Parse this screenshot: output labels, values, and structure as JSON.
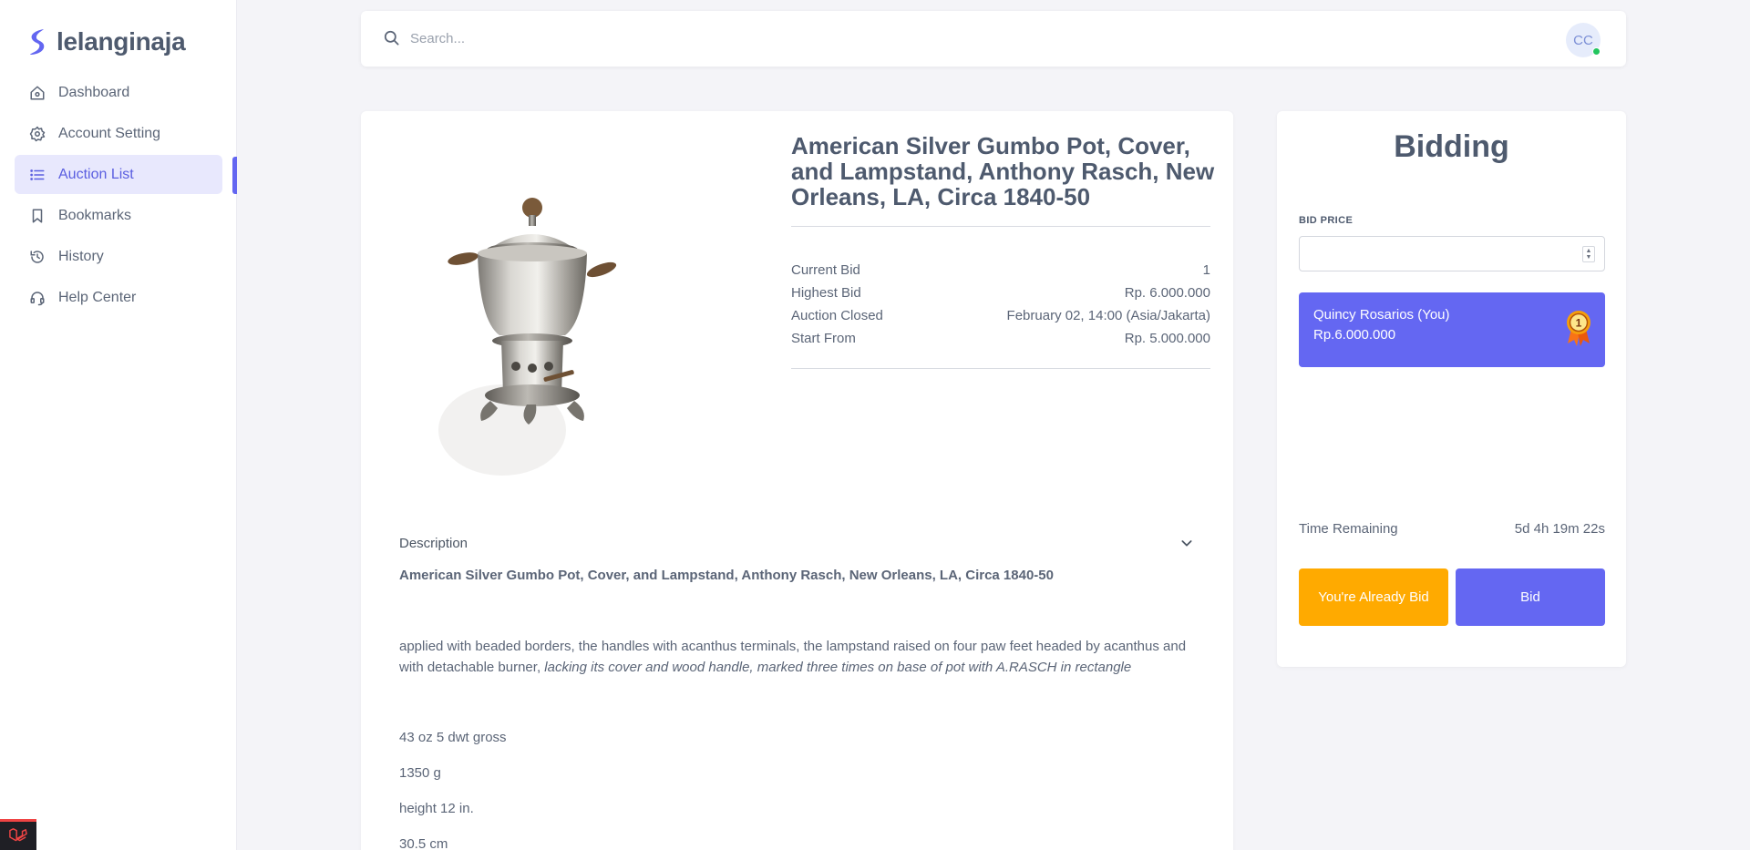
{
  "brand": {
    "name": "lelanginaja"
  },
  "sidebar": {
    "items": [
      {
        "label": "Dashboard",
        "icon": "home-icon",
        "active": false
      },
      {
        "label": "Account Setting",
        "icon": "gear-icon",
        "active": false
      },
      {
        "label": "Auction List",
        "icon": "list-icon",
        "active": true
      },
      {
        "label": "Bookmarks",
        "icon": "bookmark-icon",
        "active": false
      },
      {
        "label": "History",
        "icon": "history-icon",
        "active": false
      },
      {
        "label": "Help Center",
        "icon": "headset-icon",
        "active": false
      }
    ]
  },
  "topbar": {
    "search_placeholder": "Search...",
    "avatar_initials": "CC",
    "online": true
  },
  "product": {
    "title": "American Silver Gumbo Pot, Cover, and Lampstand, Anthony Rasch, New Orleans, LA, Circa 1840-50",
    "image": "silver-gumbo-pot",
    "info": [
      {
        "label": "Current Bid",
        "value": "1"
      },
      {
        "label": "Highest Bid",
        "value": "Rp. 6.000.000"
      },
      {
        "label": "Auction Closed",
        "value": "February 02, 14:00 (Asia/Jakarta)"
      },
      {
        "label": "Start From",
        "value": "Rp. 5.000.000"
      }
    ],
    "description": {
      "label": "Description",
      "title": "American Silver Gumbo Pot, Cover, and Lampstand, Anthony Rasch, New Orleans, LA, Circa 1840-50",
      "body_plain": "applied with beaded borders, the handles with acanthus terminals, the lampstand raised on four paw feet headed by acanthus and with detachable burner,",
      "body_italic": "lacking its cover and wood handle, marked three times on base of pot with A.RASCH in rectangle",
      "measurements": [
        "43 oz 5 dwt gross",
        "1350 g",
        "height 12 in.",
        "30.5 cm"
      ]
    }
  },
  "bidding": {
    "heading": "Bidding",
    "price_label": "BID PRICE",
    "price_value": "",
    "leader_name": "Quincy Rosarios (You)",
    "leader_amount": "Rp.6.000.000",
    "leader_rank": "1",
    "time_label": "Time Remaining",
    "time_value": "5d 4h 19m 22s",
    "already_bid_label": "You're Already Bid",
    "bid_label": "Bid",
    "colors": {
      "primary": "#6467f2",
      "warning": "#ffaa00"
    }
  }
}
